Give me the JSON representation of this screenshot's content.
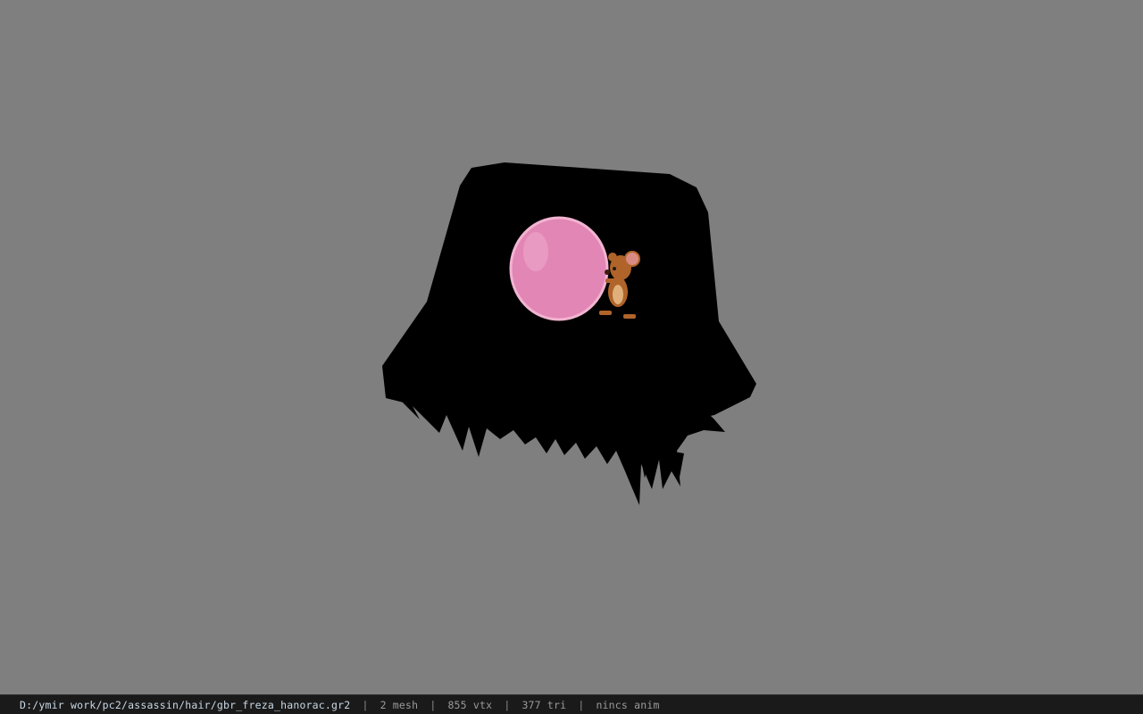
{
  "viewport": {
    "background": "#7f7f7f",
    "model": {
      "description_icon": "bucket-hat-hair-model",
      "hat_color": "#000000",
      "bubble_color": "#e286b6",
      "mouse_color": "#b0642a"
    }
  },
  "statusbar": {
    "file_path": "D:/ymir work/pc2/assassin/hair/gbr_freza_hanorac.gr2",
    "separator": "|",
    "mesh": "2 mesh",
    "vertices": "855 vtx",
    "triangles": "377 tri",
    "anim": "nincs anim"
  }
}
